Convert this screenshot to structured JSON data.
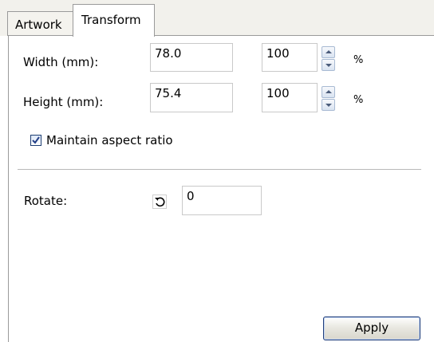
{
  "tabs": [
    {
      "label": "Artwork",
      "active": false
    },
    {
      "label": "Transform",
      "active": true
    }
  ],
  "width": {
    "label": "Width (mm):",
    "value_mm": "78.0",
    "percent": "100",
    "percent_sign": "%"
  },
  "height": {
    "label": "Height (mm):",
    "value_mm": "75.4",
    "percent": "100",
    "percent_sign": "%"
  },
  "aspect_ratio": {
    "label": "Maintain aspect ratio",
    "checked": true
  },
  "rotate": {
    "label": "Rotate:",
    "value": "0",
    "icon": "rotate-left-icon"
  },
  "apply_button": {
    "label": "Apply"
  },
  "colors": {
    "panel_bg": "#ffffff",
    "tabbar_bg": "#f2f1ec",
    "button_border": "#1f3d7a",
    "checkbox_border": "#1f3f73",
    "spin_border": "#a8bad3"
  }
}
